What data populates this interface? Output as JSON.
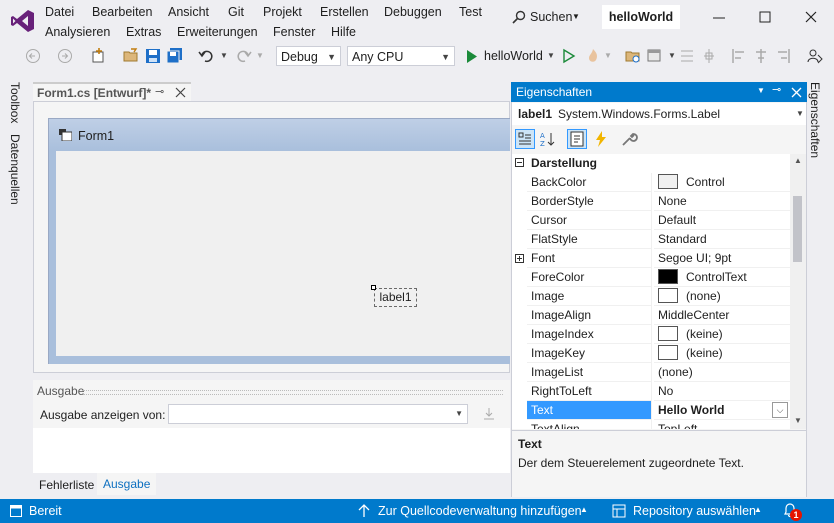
{
  "menu": {
    "row1": [
      "Datei",
      "Bearbeiten",
      "Ansicht",
      "Git",
      "Projekt",
      "Erstellen",
      "Debuggen",
      "Test"
    ],
    "row2": [
      "Analysieren",
      "Extras",
      "Erweiterungen",
      "Fenster",
      "Hilfe"
    ],
    "search_label": "Suchen",
    "solution_name": "helloWorld"
  },
  "toolbar": {
    "config": "Debug",
    "platform": "Any CPU",
    "start_label": "helloWorld"
  },
  "side_tabs": {
    "toolbox": "Toolbox",
    "datasources": "Datenquellen",
    "properties": "Eigenschaften"
  },
  "designer": {
    "tab_label": "Form1.cs [Entwurf]*",
    "form_title": "Form1",
    "label_text": "label1"
  },
  "output": {
    "title": "Ausgabe",
    "show_from_label": "Ausgabe anzeigen von:",
    "show_from_value": "",
    "tabs": [
      "Fehlerliste",
      "Ausgabe"
    ],
    "active_tab": "Ausgabe"
  },
  "properties": {
    "title": "Eigenschaften",
    "object_name": "label1",
    "object_type": "System.Windows.Forms.Label",
    "category": "Darstellung",
    "rows": [
      {
        "name": "BackColor",
        "value": "Control",
        "swatch": "#f0f0f0"
      },
      {
        "name": "BorderStyle",
        "value": "None"
      },
      {
        "name": "Cursor",
        "value": "Default"
      },
      {
        "name": "FlatStyle",
        "value": "Standard"
      },
      {
        "name": "Font",
        "value": "Segoe UI; 9pt",
        "expandable": true
      },
      {
        "name": "ForeColor",
        "value": "ControlText",
        "swatch": "#000000"
      },
      {
        "name": "Image",
        "value": "(none)",
        "swatch": "#ffffff"
      },
      {
        "name": "ImageAlign",
        "value": "MiddleCenter"
      },
      {
        "name": "ImageIndex",
        "value": "(keine)",
        "swatch": "#ffffff"
      },
      {
        "name": "ImageKey",
        "value": "(keine)",
        "swatch": "#ffffff"
      },
      {
        "name": "ImageList",
        "value": "(none)"
      },
      {
        "name": "RightToLeft",
        "value": "No"
      },
      {
        "name": "Text",
        "value": "Hello World",
        "selected": true
      },
      {
        "name": "TextAlign",
        "value": "TopLeft"
      }
    ],
    "desc_title": "Text",
    "desc_text": "Der dem Steuerelement zugeordnete Text."
  },
  "statusbar": {
    "ready": "Bereit",
    "source_control": "Zur Quellcodeverwaltung hinzufügen",
    "repository": "Repository auswählen",
    "notifications": "1"
  },
  "colors": {
    "accent": "#007acc",
    "selection": "#3399ff",
    "vs_purple": "#68217a"
  }
}
